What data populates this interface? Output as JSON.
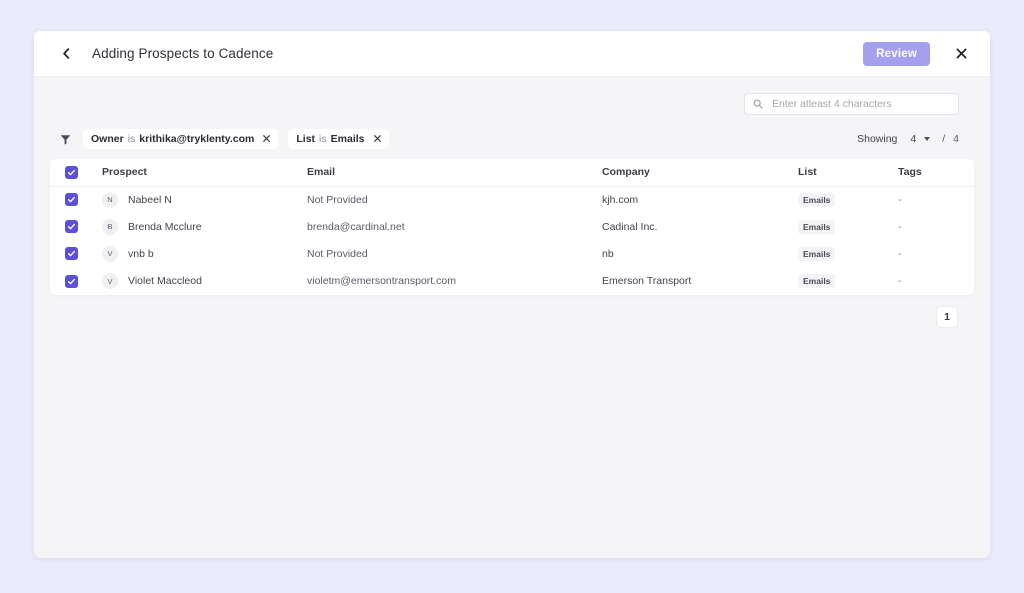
{
  "window": {
    "background_color": "#ebebfb",
    "panel_color": "#f5f5f7"
  },
  "header": {
    "back_icon": "chevron-left-icon",
    "title": "Adding Prospects to Cadence",
    "review_label": "Review",
    "review_color": "#a5a0ee",
    "close_icon": "close-icon"
  },
  "search": {
    "icon": "search-icon",
    "placeholder": "Enter atleast 4 characters",
    "value": ""
  },
  "filters": {
    "icon": "filter-icon",
    "chips": [
      {
        "field": "Owner",
        "operator": "is",
        "value": "krithika@tryklenty.com",
        "remove_icon": "close-icon"
      },
      {
        "field": "List",
        "operator": "is",
        "value": "Emails",
        "remove_icon": "close-icon"
      }
    ]
  },
  "showing": {
    "label": "Showing",
    "selected": "4",
    "options": [
      "4"
    ],
    "caret_icon": "chevron-down-icon",
    "separator": "/",
    "total": "4"
  },
  "table": {
    "select_all_checked": true,
    "columns": [
      "Prospect",
      "Email",
      "Company",
      "List",
      "Tags"
    ],
    "rows": [
      {
        "checked": true,
        "avatar": "N",
        "prospect": "Nabeel N",
        "email": "Not Provided",
        "company": "kjh.com",
        "list": "Emails",
        "tags": "-"
      },
      {
        "checked": true,
        "avatar": "B",
        "prospect": "Brenda Mcclure",
        "email": "brenda@cardinal.net",
        "company": "Cadinal Inc.",
        "list": "Emails",
        "tags": "-"
      },
      {
        "checked": true,
        "avatar": "V",
        "prospect": "vnb b",
        "email": "Not Provided",
        "company": "nb",
        "list": "Emails",
        "tags": "-"
      },
      {
        "checked": true,
        "avatar": "V",
        "prospect": "Violet Maccleod",
        "email": "violetm@emersontransport.com",
        "company": "Emerson Transport",
        "list": "Emails",
        "tags": "-"
      }
    ]
  },
  "pagination": {
    "pages": [
      "1"
    ],
    "current": "1"
  },
  "colors": {
    "accent": "#5b51d8",
    "accent_muted": "#a5a0ee",
    "badge_bg": "#f4f4f7"
  }
}
